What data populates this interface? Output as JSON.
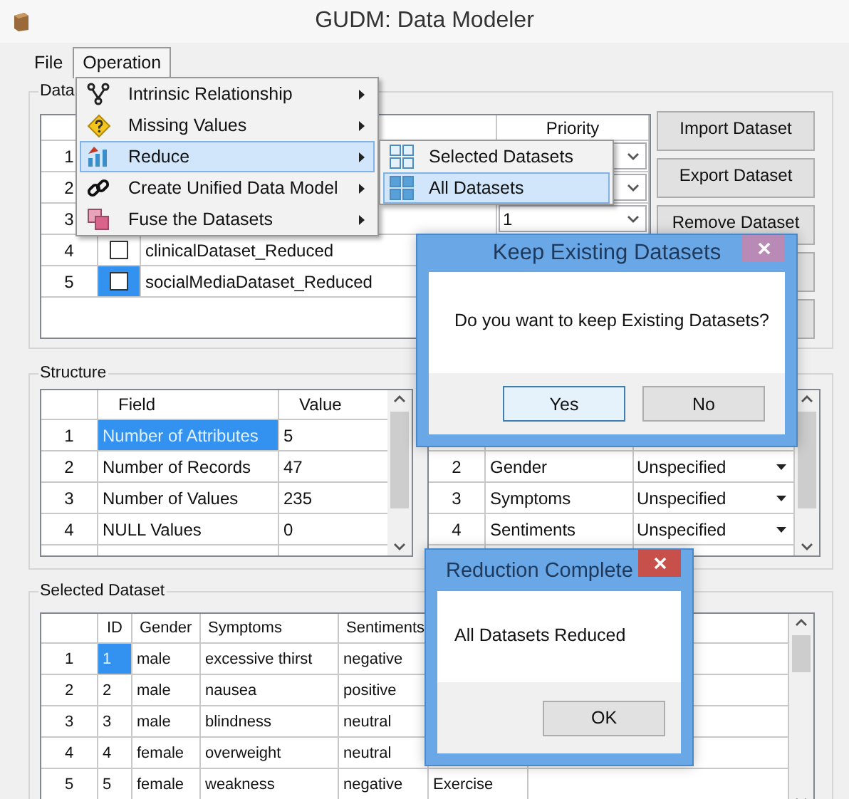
{
  "window": {
    "title": "GUDM: Data Modeler"
  },
  "menu_bar": [
    {
      "label": "File",
      "selected": false
    },
    {
      "label": "Operation",
      "selected": true
    }
  ],
  "operation_menu": [
    {
      "label": "Intrinsic Relationship",
      "selected": false
    },
    {
      "label": "Missing Values",
      "selected": false
    },
    {
      "label": "Reduce",
      "selected": true
    },
    {
      "label": "Create Unified Data Model",
      "selected": false
    },
    {
      "label": "Fuse the Datasets",
      "selected": false
    }
  ],
  "reduce_submenu": [
    {
      "label": "Selected Datasets",
      "selected": false
    },
    {
      "label": "All Datasets",
      "selected": true
    }
  ],
  "data_group": {
    "title": "Data",
    "priority_header": "Priority",
    "rows": [
      {
        "num": "1"
      },
      {
        "num": "2"
      },
      {
        "num": "3",
        "priority": "1"
      },
      {
        "num": "4",
        "name": "clinicalDataset_Reduced",
        "checked": false,
        "selected": false
      },
      {
        "num": "5",
        "name": "socialMediaDataset_Reduced",
        "checked": false,
        "selected": true
      }
    ],
    "buttons": [
      {
        "label": "Import Dataset"
      },
      {
        "label": "Export Dataset"
      },
      {
        "label": "Remove Dataset"
      }
    ]
  },
  "structure": {
    "title": "Structure",
    "columns": [
      "Field",
      "Value"
    ],
    "rows": [
      {
        "num": "1",
        "field": "Number of Attributes",
        "value": "5",
        "selected": true
      },
      {
        "num": "2",
        "field": "Number of Records",
        "value": "47",
        "selected": false
      },
      {
        "num": "3",
        "field": "Number of Values",
        "value": "235",
        "selected": false
      },
      {
        "num": "4",
        "field": "NULL Values",
        "value": "0",
        "selected": false
      }
    ]
  },
  "attribute_types": {
    "rows": [
      {
        "num": "2",
        "field": "Gender",
        "type": "Unspecified"
      },
      {
        "num": "3",
        "field": "Symptoms",
        "type": "Unspecified"
      },
      {
        "num": "4",
        "field": "Sentiments",
        "type": "Unspecified"
      }
    ]
  },
  "selected_dataset": {
    "title": "Selected Dataset",
    "columns": [
      "ID",
      "Gender",
      "Symptoms",
      "Sentiments"
    ],
    "rows": [
      {
        "num": "1",
        "cells": [
          "1",
          "male",
          "excessive thirst",
          "negative"
        ],
        "selected": true
      },
      {
        "num": "2",
        "cells": [
          "2",
          "male",
          "nausea",
          "positive"
        ],
        "selected": false
      },
      {
        "num": "3",
        "cells": [
          "3",
          "male",
          "blindness",
          "neutral"
        ],
        "selected": false
      },
      {
        "num": "4",
        "cells": [
          "4",
          "female",
          "overweight",
          "neutral"
        ],
        "selected": false
      },
      {
        "num": "5",
        "cells": [
          "5",
          "female",
          "weakness",
          "negative",
          "Exercise"
        ],
        "selected": false
      }
    ]
  },
  "dialogs": [
    {
      "title": "Keep Existing Datasets",
      "active": false,
      "message": "Do you want to keep Existing Datasets?",
      "buttons": [
        {
          "label": "Yes",
          "selected": true
        },
        {
          "label": "No",
          "selected": false
        }
      ]
    },
    {
      "title": "Reduction Complete",
      "active": true,
      "message": "All Datasets Reduced",
      "buttons": [
        {
          "label": "OK",
          "selected": false
        }
      ]
    }
  ]
}
